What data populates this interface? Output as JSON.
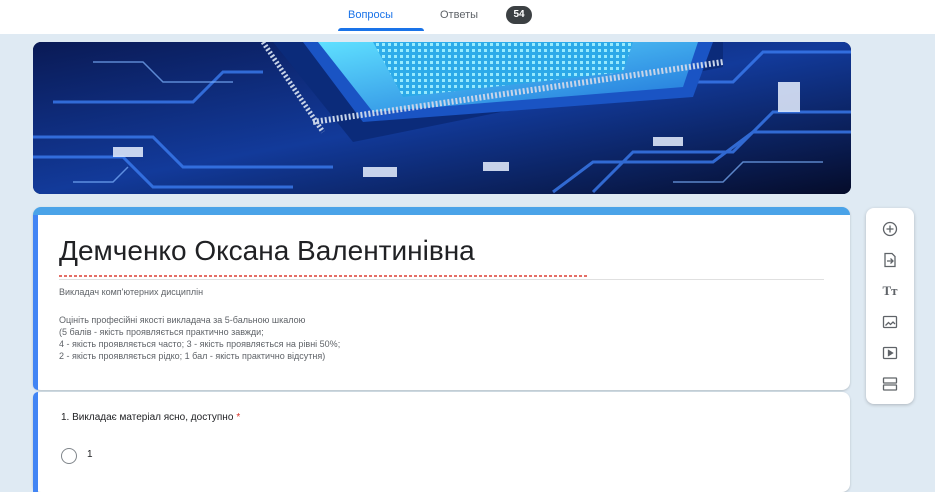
{
  "tabs": [
    {
      "label": "Вопросы",
      "active": true
    },
    {
      "label": "Ответы",
      "active": false
    }
  ],
  "responses_count": "54",
  "form": {
    "title": "Демченко Оксана Валентинівна",
    "subtitle": "Викладач комп'ютерних дисциплін",
    "description_lines": [
      "Оцініть професійні якості викладача за 5-бальною шкалою",
      "(5 балів - якість проявляється практично завжди;",
      "4 - якість проявляється часто; 3 - якість проявляється на рівні 50%;",
      "2 - якість проявляється рідко; 1 бал - якість практично відсутня)"
    ]
  },
  "question": {
    "text": "1. Викладає матеріал ясно, доступно",
    "required_mark": "*",
    "options": [
      "1"
    ]
  },
  "toolbar": {
    "items": [
      "add-question-icon",
      "import-questions-icon",
      "add-title-icon",
      "add-image-icon",
      "add-video-icon",
      "add-section-icon"
    ],
    "title_glyph": "Tт"
  },
  "colors": {
    "accent": "#1a73e8",
    "card_border": "#4285f4",
    "background": "#dfeaf3",
    "required": "#d93025"
  }
}
